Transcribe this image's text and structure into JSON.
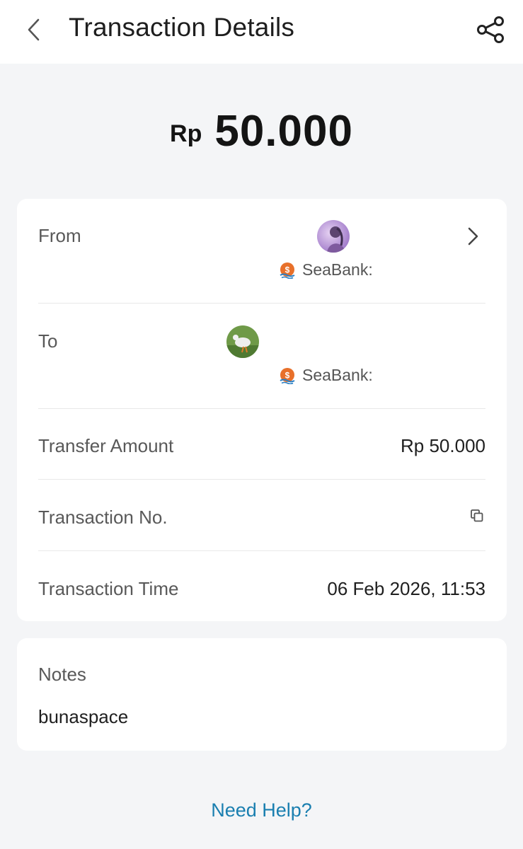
{
  "header": {
    "title": "Transaction Details",
    "back_icon": "chevron-left-icon",
    "share_icon": "share-icon"
  },
  "amount": {
    "currency": "Rp",
    "value": "50.000"
  },
  "details": {
    "from": {
      "label": "From",
      "bank": "SeaBank:",
      "bank_icon": "seabank-icon"
    },
    "to": {
      "label": "To",
      "bank": "SeaBank:",
      "bank_icon": "seabank-icon"
    },
    "transfer_amount": {
      "label": "Transfer Amount",
      "value": "Rp 50.000"
    },
    "transaction_no": {
      "label": "Transaction No.",
      "copy_icon": "copy-icon"
    },
    "transaction_time": {
      "label": "Transaction Time",
      "value": "06 Feb 2026, 11:53"
    }
  },
  "notes": {
    "label": "Notes",
    "value": "bunaspace"
  },
  "help": {
    "label": "Need Help?"
  },
  "colors": {
    "background": "#f4f5f7",
    "card": "#ffffff",
    "link": "#1a7fb0",
    "seabank_orange": "#e8702a"
  }
}
